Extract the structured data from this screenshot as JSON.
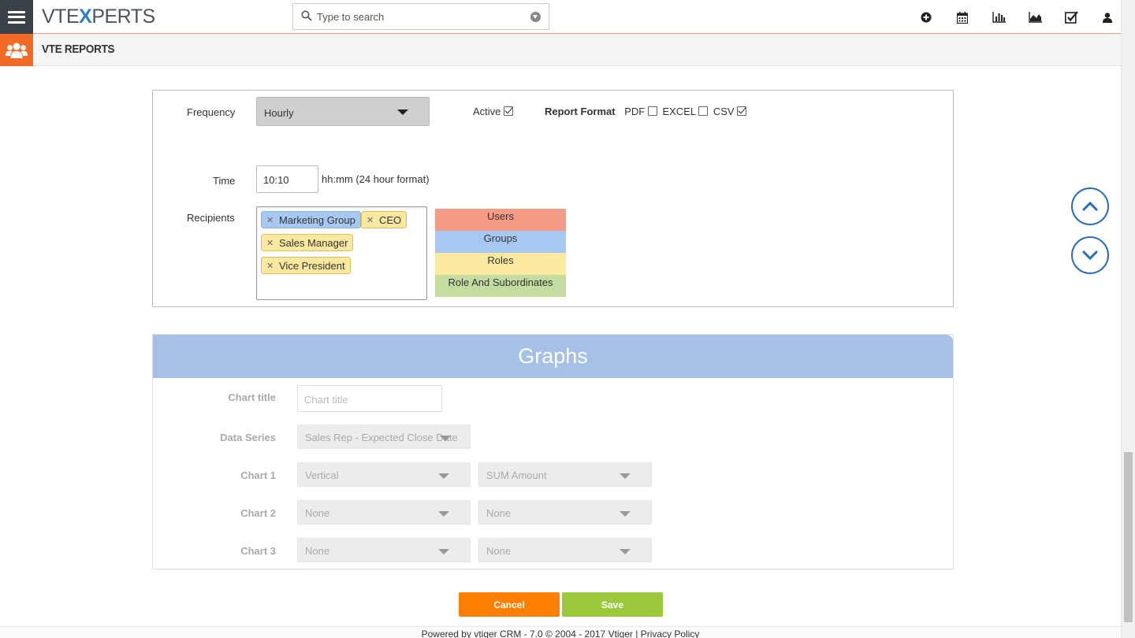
{
  "header": {
    "logo_prefix": "VTE",
    "logo_x": "X",
    "logo_suffix": "PERTS",
    "search_placeholder": "Type to search",
    "icons": [
      "plus-circle-icon",
      "calendar-icon",
      "bar-chart-icon",
      "area-chart-icon",
      "checkbox-icon",
      "user-icon"
    ]
  },
  "module": {
    "title": "VTE REPORTS"
  },
  "schedule": {
    "frequency_label": "Frequency",
    "frequency_value": "Hourly",
    "active_label": "Active",
    "active_checked": true,
    "report_format_label": "Report Format",
    "formats": [
      {
        "label": "PDF",
        "checked": false
      },
      {
        "label": "EXCEL",
        "checked": false
      },
      {
        "label": "CSV",
        "checked": true
      }
    ],
    "time_label": "Time",
    "time_value": "10:10",
    "time_hint": "hh:mm (24 hour format)",
    "recipients_label": "Recipients",
    "recipients": [
      {
        "name": "Marketing Group",
        "type": "group"
      },
      {
        "name": "CEO",
        "type": "role"
      },
      {
        "name": "Sales Manager",
        "type": "role"
      },
      {
        "name": "Vice President",
        "type": "role"
      }
    ],
    "legend": [
      {
        "label": "Users",
        "color": "#f59b86"
      },
      {
        "label": "Groups",
        "color": "#a7c8f0"
      },
      {
        "label": "Roles",
        "color": "#fbe9a0"
      },
      {
        "label": "Role And Subordinates",
        "color": "#c4dca0"
      }
    ]
  },
  "graphs": {
    "title": "Graphs",
    "chart_title_label": "Chart title",
    "chart_title_placeholder": "Chart title",
    "data_series_label": "Data Series",
    "data_series_value": "Sales Rep - Expected Close Date",
    "charts": [
      {
        "label": "Chart 1",
        "type": "Vertical",
        "field": "SUM Amount"
      },
      {
        "label": "Chart 2",
        "type": "None",
        "field": "None"
      },
      {
        "label": "Chart 3",
        "type": "None",
        "field": "None"
      }
    ]
  },
  "actions": {
    "cancel": "Cancel",
    "save": "Save"
  },
  "footer": {
    "text": "Powered by vtiger CRM - 7.0  © 2004 - 2017  Vtiger |  Privacy Policy"
  },
  "colors": {
    "accent_orange": "#f26b25",
    "cancel": "#ff8000",
    "save": "#9bc93b",
    "graphs_header": "#a6c1e5",
    "nav_blue": "#2a6cb8"
  }
}
